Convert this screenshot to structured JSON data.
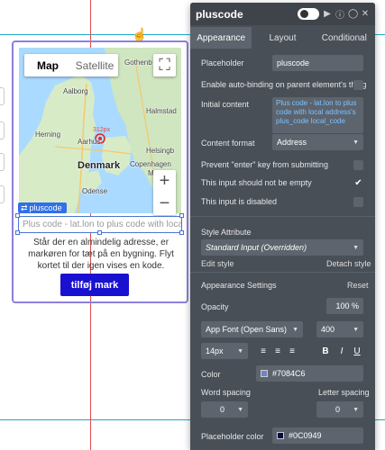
{
  "map": {
    "type_map": "Map",
    "type_satellite": "Satellite",
    "zoom_in": "+",
    "zoom_out": "−",
    "fullscreen": "⛶",
    "pin_label": "312px",
    "places": {
      "gothenburg": "Gothenb",
      "aalborg": "Aalborg",
      "halmstad": "Halmstad",
      "herning": "Herning",
      "aarhus": "Aarhus",
      "denmark": "Denmark",
      "helsingborg": "Helsingb",
      "copenhagen": "Copenhagen",
      "malmo": "Malmo",
      "odense": "Odense"
    }
  },
  "canvas": {
    "element_tag": "pluscode",
    "input_placeholder": "Plus code - lat.lon to plus code with local ad",
    "description": "Står der en almindelig adresse, er markøren for tæt på en bygning. Flyt kortet til der igen vises en kode.",
    "add_button": "tilføj mark"
  },
  "panel": {
    "title": "pluscode",
    "tabs": [
      "Appearance",
      "Layout",
      "Conditional"
    ],
    "placeholder_label": "Placeholder",
    "placeholder_value": "pluscode",
    "autobind_label": "Enable auto-binding on parent element's thing",
    "initial_content_label": "Initial content",
    "initial_content_value": "Plus code - lat.lon to plus code with local address's plus_code local_code",
    "content_format_label": "Content format",
    "content_format_value": "Address",
    "prevent_enter_label": "Prevent \"enter\" key from submitting",
    "not_empty_label": "This input should not be empty",
    "disabled_label": "This input is disabled",
    "style_attribute_label": "Style Attribute",
    "style_value": "Standard Input (Overridden)",
    "edit_style": "Edit style",
    "detach_style": "Detach style",
    "appearance_settings": "Appearance Settings",
    "reset": "Reset",
    "opacity_label": "Opacity",
    "opacity_value": "100 %",
    "font_value": "App Font (Open Sans)",
    "font_weight": "400",
    "font_size": "14px",
    "bold": "B",
    "italic": "I",
    "underline": "U",
    "color_label": "Color",
    "color_value": "#7084C6",
    "word_spacing_label": "Word spacing",
    "letter_spacing_label": "Letter spacing",
    "word_spacing_value": "0",
    "letter_spacing_value": "0",
    "placeholder_color_label": "Placeholder color",
    "placeholder_color_value": "#0C0949"
  },
  "colors": {
    "accent": "#1a10d0",
    "panel_bg": "#494f57",
    "selection": "#8b80dc",
    "guide_h": "#1ea7c9",
    "guide_v": "#e24a4a",
    "color_swatch": "#7084C6",
    "placeholder_swatch": "#0C0949"
  }
}
